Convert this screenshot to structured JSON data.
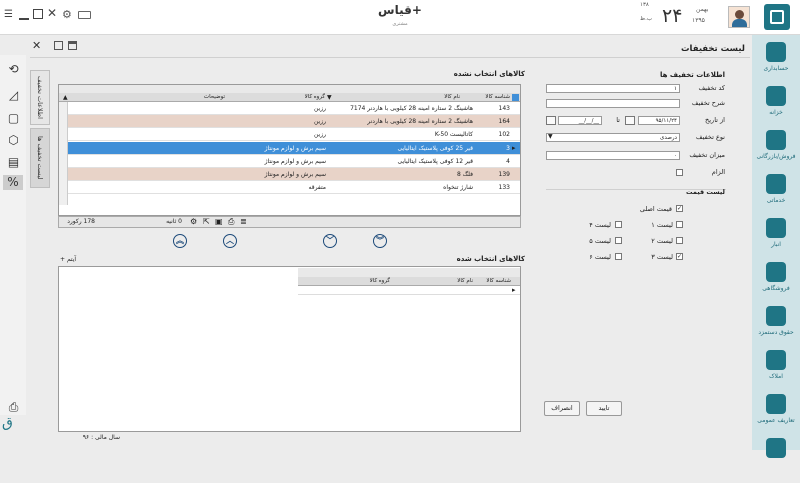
{
  "topbar": {
    "app_title": "قیاس+",
    "app_subtitle": "مشتری",
    "day_number": "۲۴",
    "month_name": "بهمن",
    "year": "۱۳۹۵",
    "small_top": "۱۳۸",
    "small_bottom": "ب.ظ"
  },
  "page": {
    "title": "لیست تخفیفات"
  },
  "side_tabs": {
    "info": "اطلاعات تخفیف",
    "list": "لیست تخفیف ها"
  },
  "form": {
    "section_title": "اطلاعات تخفیف ها",
    "code_label": "کد تخفیف",
    "code_value": "۱",
    "desc_label": "شرح تخفیف",
    "from_label": "از تاریخ",
    "from_value": "۹۵/۱۱/۲۴",
    "to_label": "تا",
    "to_value": "__/__/__",
    "type_label": "نوع تخفیف",
    "type_value": "درصدی",
    "amount_label": "میزان تخفیف",
    "amount_value": "۰",
    "required_label": "الزام",
    "price_list_title": "لیست قیمت",
    "price_main": "قیمت اصلی",
    "list1": "لیست ۱",
    "list2": "لیست ۲",
    "list3": "لیست ۳",
    "list4": "لیست ۴",
    "list5": "لیست ۵",
    "list6": "لیست ۶"
  },
  "unselected": {
    "title": "کالاهای انتخاب نشده",
    "columns": [
      "شناسه کالا",
      "نام کالا",
      "گروه کالا",
      "توضیحات"
    ],
    "rows": [
      {
        "id": "143",
        "name": "هاشینگ 2 ستاره امینه 28 کیلویی با هاردنر 7174",
        "group": "رزین",
        "desc": ""
      },
      {
        "id": "164",
        "name": "هاشینگ 2 ستاره امینه 28 کیلویی با هاردنر",
        "group": "رزین",
        "desc": ""
      },
      {
        "id": "102",
        "name": "کاتالیست K-50",
        "group": "رزین",
        "desc": ""
      },
      {
        "id": "3",
        "name": "قیر 25 کوفی پلاستیک ایتالیایی",
        "group": "سیم برش و لوازم مونتاژ",
        "desc": ""
      },
      {
        "id": "4",
        "name": "قیر 12 کوفی پلاستیک ایتالیایی",
        "group": "سیم برش و لوازم مونتاژ",
        "desc": ""
      },
      {
        "id": "139",
        "name": "فلگ 8",
        "group": "سیم برش و لوازم مونتاژ",
        "desc": ""
      },
      {
        "id": "133",
        "name": "شارژ تنخواه",
        "group": "متفرقه",
        "desc": ""
      }
    ],
    "record_count": "178 رکورد",
    "time": "0 ثانیه"
  },
  "selected": {
    "title": "کالاهای انتخاب شده",
    "columns": [
      "شناسه کالا",
      "نام کالا",
      "گروه کالا"
    ],
    "items_label": "+ آیتم"
  },
  "buttons": {
    "confirm": "تایید",
    "cancel": "انصراف"
  },
  "footer": {
    "fiscal_year": "سال مالی : ۹۶"
  },
  "nav": [
    {
      "label": "حسابداری",
      "icon": "calculator-icon"
    },
    {
      "label": "خزانه",
      "icon": "treasury-icon"
    },
    {
      "label": "فروش/بازرگانی",
      "icon": "globe-icon"
    },
    {
      "label": "خدماتی",
      "icon": "gear-icon"
    },
    {
      "label": "انبار",
      "icon": "warehouse-icon"
    },
    {
      "label": "فروشگاهی",
      "icon": "store-icon"
    },
    {
      "label": "حقوق دستمزد",
      "icon": "payroll-icon"
    },
    {
      "label": "املاک",
      "icon": "house-icon"
    },
    {
      "label": "تعاریف عمومی",
      "icon": "definitions-icon"
    },
    {
      "label": "",
      "icon": "chart-icon"
    }
  ],
  "colors": {
    "accent": "#1f7585",
    "selected_row": "#3f8fd8",
    "alt_row": "#e8d3c8"
  }
}
